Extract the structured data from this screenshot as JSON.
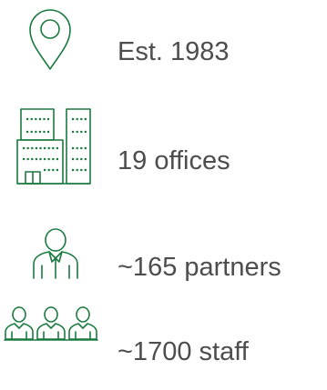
{
  "facts": [
    {
      "icon": "location-pin-icon",
      "text": "Est. 1983"
    },
    {
      "icon": "office-buildings-icon",
      "text": "19 offices"
    },
    {
      "icon": "partner-person-icon",
      "text": "~165 partners"
    },
    {
      "icon": "staff-people-icon",
      "text": "~1700 staff"
    }
  ],
  "colors": {
    "icon": "#1a7a3f",
    "text": "#4d4d4d"
  }
}
